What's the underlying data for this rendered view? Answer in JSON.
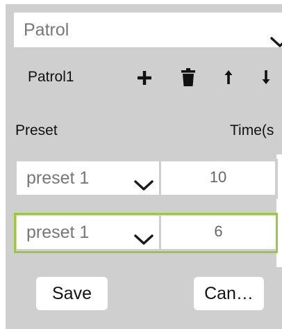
{
  "patrol_select": {
    "value": "Patrol",
    "icon": "chevron-down-icon"
  },
  "toolbar": {
    "patrol_name": "Patrol1",
    "add_icon": "plus-icon",
    "delete_icon": "trash-icon",
    "up_icon": "arrow-up-icon",
    "down_icon": "arrow-down-icon"
  },
  "columns": {
    "preset": "Preset",
    "time": "Time(s"
  },
  "rows": [
    {
      "preset": "preset 1",
      "time": "10",
      "selected": false
    },
    {
      "preset": "preset 1",
      "time": "6",
      "selected": true
    }
  ],
  "buttons": {
    "save": "Save",
    "cancel": "Can…"
  },
  "colors": {
    "panel": "#cfcfcf",
    "selected_border": "#9bc83e",
    "field": "#ffffff"
  }
}
